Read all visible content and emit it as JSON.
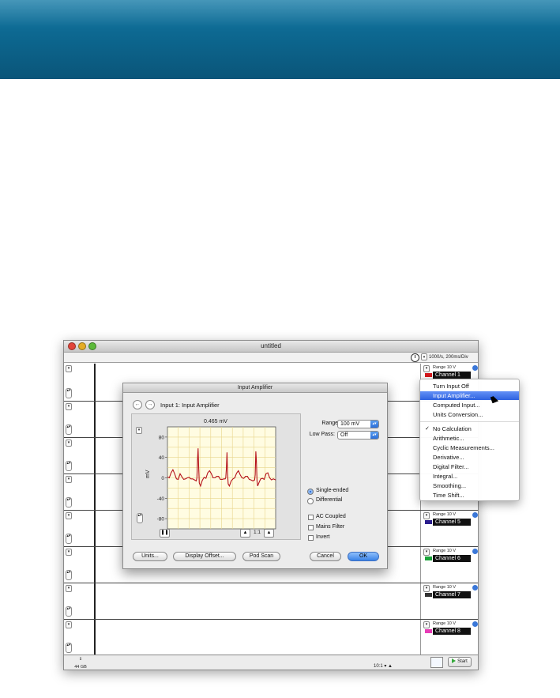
{
  "window": {
    "title": "untitled"
  },
  "toolbar": {
    "rate": "1000/s, 200ms/Div"
  },
  "channels": [
    {
      "range": "Range 10 V",
      "name": "Channel 1",
      "color": "#d6191e"
    },
    {
      "range": "Range 10 V",
      "name": "Channel 5",
      "color": "#2b1e8e"
    },
    {
      "range": "Range 10 V",
      "name": "Channel 6",
      "color": "#1ba33a"
    },
    {
      "range": "Range 10 V",
      "name": "Channel 7",
      "color": "#333333"
    },
    {
      "range": "Range 10 V",
      "name": "Channel 8",
      "color": "#e83bb7"
    }
  ],
  "bottom": {
    "disk": "44 GB",
    "zoom": "10:1",
    "start": "Start"
  },
  "dialog": {
    "title": "Input Amplifier",
    "header": "Input 1: Input Amplifier",
    "readout": "0.465 mV",
    "range_label": "Range:",
    "range_value": "100 mV",
    "lowpass_label": "Low Pass:",
    "lowpass_value": "Off",
    "single_ended": "Single-ended",
    "differential": "Differential",
    "ac_coupled": "AC Coupled",
    "mains_filter": "Mains Filter",
    "invert": "Invert",
    "zoom_label": "1:1",
    "buttons": {
      "units": "Units...",
      "display_offset": "Display Offset...",
      "pod_scan": "Pod Scan",
      "cancel": "Cancel",
      "ok": "OK"
    }
  },
  "chart_data": {
    "type": "line",
    "ylabel": "mV",
    "ylim": [
      -100,
      100
    ],
    "yticks": [
      "80",
      "40",
      "0",
      "-40",
      "-80"
    ],
    "ytick_values": [
      80,
      40,
      0,
      -40,
      -80
    ],
    "series": [
      {
        "color": "#b5121b",
        "x": [
          0,
          3,
          6,
          9,
          12,
          15,
          18,
          21,
          24,
          27,
          30,
          33,
          36,
          39,
          42,
          45,
          48,
          49,
          50,
          51,
          52,
          53,
          55,
          58,
          61,
          64,
          67,
          70,
          73,
          76,
          79,
          82,
          85,
          88,
          91,
          94,
          96,
          97,
          98,
          99,
          100,
          101,
          103,
          106,
          109,
          112,
          115,
          118,
          121,
          124,
          127,
          130,
          133,
          136,
          139,
          142,
          145,
          146,
          147,
          148,
          149,
          150,
          152,
          155,
          158,
          161,
          164,
          167,
          170,
          173,
          176,
          180
        ],
        "y": [
          2,
          0,
          10,
          16,
          8,
          -2,
          -3,
          8,
          2,
          -3,
          -2,
          0,
          1,
          -2,
          -2,
          -4,
          -6,
          0,
          36,
          58,
          18,
          -10,
          -16,
          -5,
          1,
          -1,
          10,
          14,
          8,
          0,
          0,
          3,
          3,
          -3,
          -3,
          -2,
          -2,
          0,
          18,
          50,
          8,
          -12,
          -16,
          -6,
          -2,
          0,
          9,
          14,
          6,
          0,
          -1,
          3,
          3,
          -3,
          -4,
          -6,
          -4,
          6,
          52,
          34,
          -6,
          -16,
          -10,
          -2,
          -1,
          -3,
          8,
          10,
          0,
          -4,
          -2,
          -4
        ]
      }
    ]
  },
  "menu": {
    "items": [
      {
        "label": "Turn Input Off"
      },
      {
        "label": "Input Amplifier...",
        "highlighted": true
      },
      {
        "label": "Computed Input..."
      },
      {
        "label": "Units Conversion..."
      },
      {
        "label": "No Calculation",
        "checked": true
      },
      {
        "label": "Arithmetic..."
      },
      {
        "label": "Cyclic Measurements..."
      },
      {
        "label": "Derivative..."
      },
      {
        "label": "Digital Filter..."
      },
      {
        "label": "Integral..."
      },
      {
        "label": "Smoothing..."
      },
      {
        "label": "Time Shift..."
      }
    ]
  }
}
